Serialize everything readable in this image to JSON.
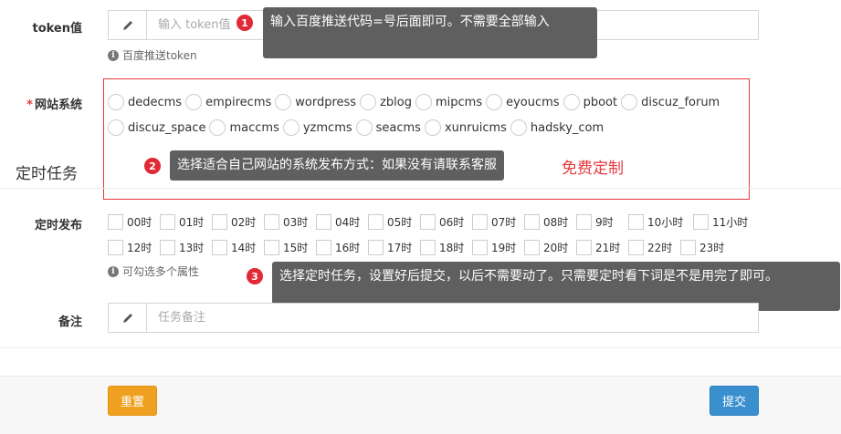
{
  "token": {
    "label": "token值",
    "placeholder": "输入 token值",
    "help": "百度推送token",
    "tip_number": "1",
    "tip": "输入百度推送代码=号后面即可。不需要全部输入"
  },
  "site_system": {
    "label": "网站系统",
    "required_mark": "*",
    "options_row1": [
      "dedecms",
      "empirecms",
      "wordpress",
      "zblog",
      "mipcms",
      "eyoucms",
      "pboot",
      "discuz_forum"
    ],
    "options_row2": [
      "discuz_space",
      "maccms",
      "yzmcms",
      "seacms",
      "xunruicms",
      "hadsky_com"
    ],
    "tip_number": "2",
    "tip": "选择适合自己网站的系统发布方式：如果没有请联系客服",
    "custom_label": "免费定制"
  },
  "section": {
    "title": "定时任务"
  },
  "schedule": {
    "label": "定时发布",
    "hours_row1": [
      "00时",
      "01时",
      "02时",
      "03时",
      "04时",
      "05时",
      "06时",
      "07时",
      "08时",
      "9时",
      "10小时",
      "11小时"
    ],
    "hours_row2": [
      "12时",
      "13时",
      "14时",
      "15时",
      "16时",
      "17时",
      "18时",
      "19时",
      "20时",
      "21时",
      "22时",
      "23时"
    ],
    "help": "可勾选多个属性",
    "tip_number": "3",
    "tip": "选择定时任务，设置好后提交，以后不需要动了。只需要定时看下词是不是用完了即可。"
  },
  "remark": {
    "label": "备注",
    "placeholder": "任务备注"
  },
  "buttons": {
    "reset": "重置",
    "submit": "提交"
  },
  "colors": {
    "reset": "#f0a020",
    "submit": "#3a8fcf",
    "badge": "#e02a35",
    "tooltip": "#5f5f5f",
    "highlight_border": "#e4393c"
  }
}
